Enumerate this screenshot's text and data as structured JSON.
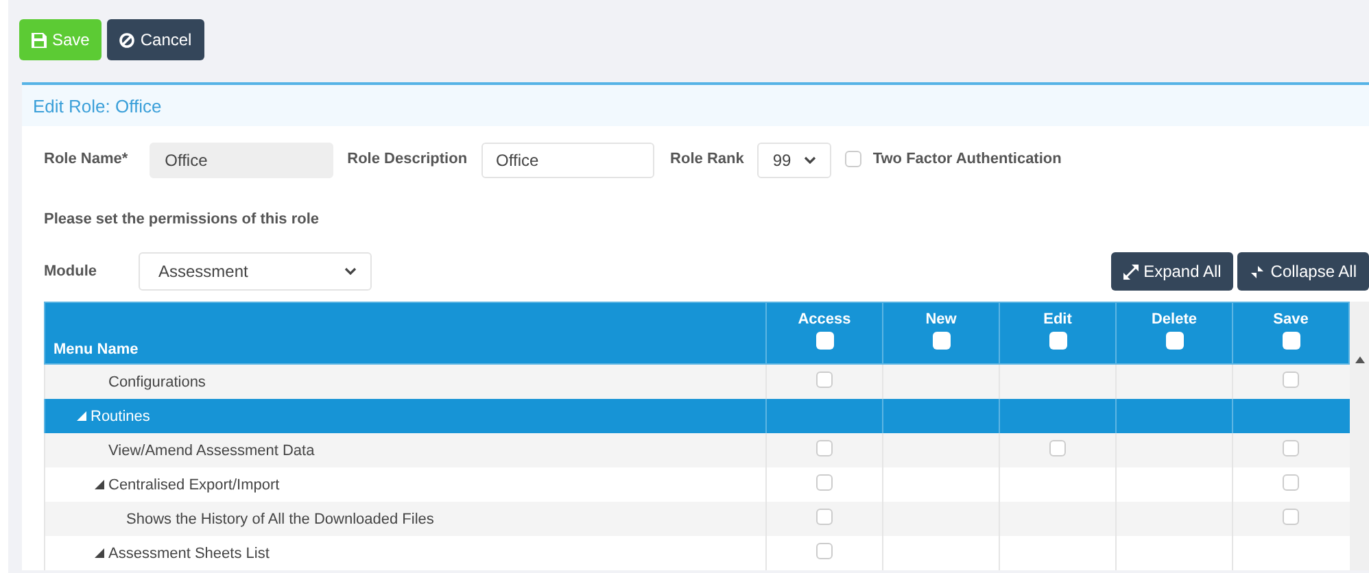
{
  "toolbar": {
    "buttons": [
      {
        "label": "Save",
        "kind": "save"
      },
      {
        "label": "Cancel",
        "kind": "cancel"
      }
    ]
  },
  "panel": {
    "title": "Edit Role: Office"
  },
  "form": {
    "role_name": {
      "label": "Role Name*",
      "value": "Office",
      "disabled": true
    },
    "role_description": {
      "label": "Role Description",
      "value": "Office",
      "disabled": false
    },
    "role_rank": {
      "label": "Role Rank",
      "value": "99"
    },
    "two_factor": {
      "label": "Two Factor Authentication",
      "checked": false
    }
  },
  "instructions": "Please set the permissions of this role",
  "module": {
    "label": "Module",
    "value": "Assessment"
  },
  "actions": [
    {
      "label": "Expand All",
      "kind": "expand"
    },
    {
      "label": "Collapse All",
      "kind": "collapse"
    }
  ],
  "table": {
    "name_column": "Menu Name",
    "columns": [
      {
        "label": "Access",
        "checked": false
      },
      {
        "label": "New",
        "checked": false
      },
      {
        "label": "Edit",
        "checked": false
      },
      {
        "label": "Delete",
        "checked": false
      },
      {
        "label": "Save",
        "checked": false
      }
    ],
    "rows": [
      {
        "children": [
          {
            "children": [
              {
                "label": "Configurations",
                "selected": false,
                "permissions": {
                  "access": {
                    "checked": false
                  },
                  "save": {
                    "checked": false
                  }
                }
              }
            ]
          },
          {
            "label": "Routines",
            "selected": true,
            "expanded": true,
            "children": [
              {
                "label": "View/Amend Assessment Data",
                "selected": false,
                "permissions": {
                  "access": {
                    "checked": false
                  },
                  "edit": {
                    "checked": false
                  },
                  "save": {
                    "checked": false
                  }
                }
              },
              {
                "label": "Centralised Export/Import",
                "selected": false,
                "expanded": true,
                "permissions": {
                  "access": {
                    "checked": false
                  },
                  "save": {
                    "checked": false
                  }
                },
                "children": [
                  {
                    "label": "Shows the History of All the Downloaded Files",
                    "selected": false,
                    "permissions": {
                      "access": {
                        "checked": false
                      },
                      "save": {
                        "checked": false
                      }
                    }
                  }
                ]
              },
              {
                "label": "Assessment Sheets List",
                "selected": false,
                "expanded": true,
                "permissions": {
                  "access": {
                    "checked": false
                  }
                }
              }
            ]
          }
        ]
      }
    ]
  }
}
